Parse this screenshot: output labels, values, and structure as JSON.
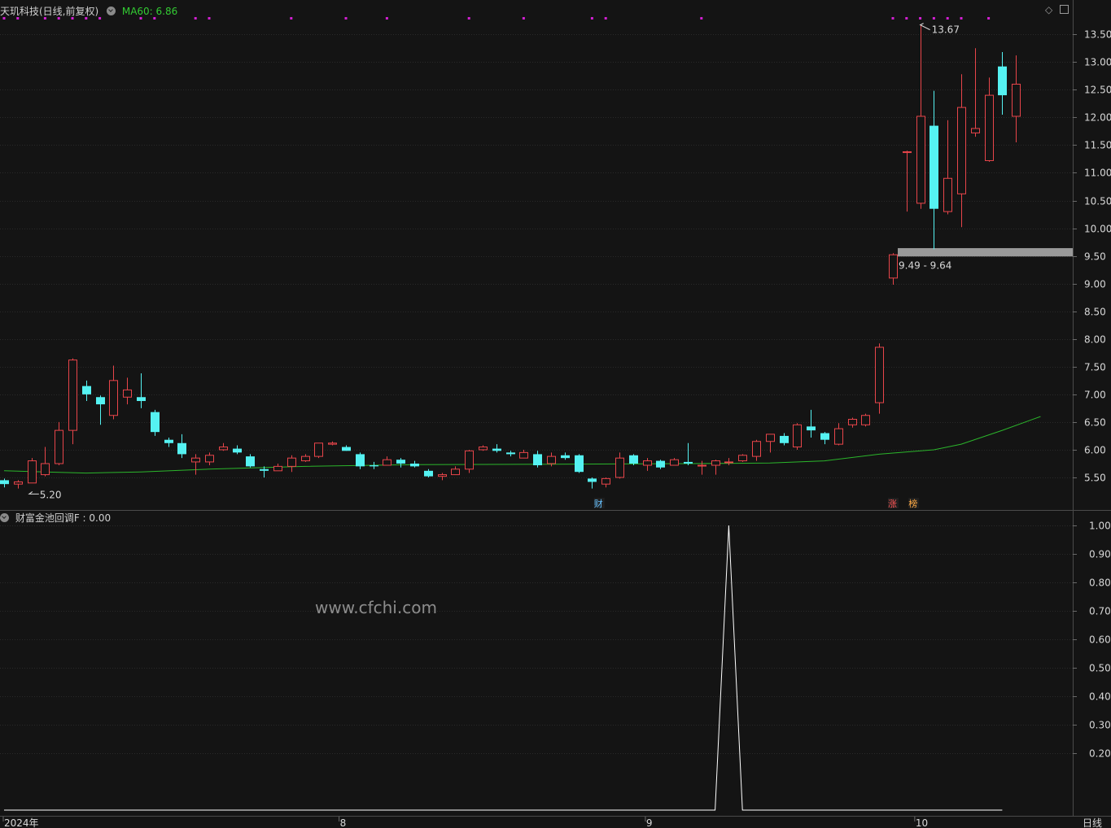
{
  "main_header": {
    "stock_name": "天玑科技(日线,前复权)",
    "ma_label": "MA60: 6.86"
  },
  "sub_header": {
    "indicator_label": "财富金池回调F : 0.00"
  },
  "watermark": "www.cfchi.com",
  "annotations": {
    "high_label": "13.67",
    "low_label": "5.20",
    "band_label": "9.49 - 9.64",
    "marker_cai": "财",
    "marker_zhang": "涨",
    "marker_bang": "榜"
  },
  "x_labels": [
    "2024年",
    "8",
    "9",
    "10"
  ],
  "period_label": "日线",
  "colors": {
    "background": "#141414",
    "up": "#e8454a",
    "down": "#55f2f2",
    "ma": "#2bb52b",
    "signal_dots": "#d21fd2",
    "indicator_line": "#ffffff",
    "band": "#9a9a9a",
    "ma_label": "#33cc33"
  },
  "chart_data": [
    {
      "type": "candlestick",
      "name": "天玑科技",
      "y_ticks": [
        "5.50",
        "6.00",
        "6.50",
        "7.00",
        "7.50",
        "8.00",
        "8.50",
        "9.00",
        "9.50",
        "10.00",
        "10.50",
        "11.00",
        "11.50",
        "12.00",
        "12.50",
        "13.00",
        "13.50"
      ],
      "ylim": [
        5.0,
        13.8
      ],
      "x_tick_labels": [
        "2024年",
        "8",
        "9",
        "10"
      ],
      "ohlc": [
        [
          5.45,
          5.48,
          5.32,
          5.38
        ],
        [
          5.38,
          5.45,
          5.3,
          5.42
        ],
        [
          5.4,
          5.85,
          5.4,
          5.8
        ],
        [
          5.55,
          6.05,
          5.52,
          5.75
        ],
        [
          5.75,
          6.5,
          5.72,
          6.35
        ],
        [
          6.35,
          7.65,
          6.1,
          7.62
        ],
        [
          7.15,
          7.25,
          6.88,
          7.0
        ],
        [
          6.95,
          6.98,
          6.45,
          6.82
        ],
        [
          6.62,
          7.52,
          6.55,
          7.25
        ],
        [
          6.95,
          7.3,
          6.82,
          7.08
        ],
        [
          6.95,
          7.38,
          6.75,
          6.88
        ],
        [
          6.68,
          6.72,
          6.25,
          6.32
        ],
        [
          6.18,
          6.22,
          6.05,
          6.12
        ],
        [
          6.12,
          6.28,
          5.85,
          5.92
        ],
        [
          5.78,
          5.92,
          5.55,
          5.85
        ],
        [
          5.78,
          5.95,
          5.72,
          5.9
        ],
        [
          6.0,
          6.12,
          5.98,
          6.05
        ],
        [
          6.02,
          6.08,
          5.92,
          5.95
        ],
        [
          5.88,
          5.92,
          5.68,
          5.7
        ],
        [
          5.65,
          5.7,
          5.5,
          5.62
        ],
        [
          5.62,
          5.75,
          5.62,
          5.7
        ],
        [
          5.7,
          5.9,
          5.6,
          5.85
        ],
        [
          5.8,
          5.92,
          5.78,
          5.88
        ],
        [
          5.88,
          6.12,
          5.85,
          6.12
        ],
        [
          6.1,
          6.15,
          6.08,
          6.12
        ],
        [
          6.05,
          6.08,
          5.98,
          5.98
        ],
        [
          5.92,
          5.95,
          5.65,
          5.7
        ],
        [
          5.72,
          5.78,
          5.65,
          5.7
        ],
        [
          5.72,
          5.88,
          5.72,
          5.82
        ],
        [
          5.82,
          5.85,
          5.68,
          5.75
        ],
        [
          5.75,
          5.8,
          5.68,
          5.7
        ],
        [
          5.62,
          5.65,
          5.5,
          5.52
        ],
        [
          5.52,
          5.58,
          5.45,
          5.55
        ],
        [
          5.55,
          5.7,
          5.55,
          5.65
        ],
        [
          5.65,
          6.0,
          5.58,
          5.98
        ],
        [
          6.0,
          6.08,
          5.98,
          6.05
        ],
        [
          6.02,
          6.1,
          5.95,
          5.98
        ],
        [
          5.95,
          5.98,
          5.88,
          5.92
        ],
        [
          5.85,
          6.0,
          5.85,
          5.95
        ],
        [
          5.92,
          5.98,
          5.68,
          5.72
        ],
        [
          5.75,
          5.95,
          5.7,
          5.88
        ],
        [
          5.9,
          5.95,
          5.82,
          5.85
        ],
        [
          5.9,
          5.92,
          5.58,
          5.6
        ],
        [
          5.48,
          5.5,
          5.3,
          5.42
        ],
        [
          5.38,
          5.5,
          5.32,
          5.48
        ],
        [
          5.5,
          5.95,
          5.48,
          5.85
        ],
        [
          5.9,
          5.92,
          5.72,
          5.75
        ],
        [
          5.72,
          5.85,
          5.62,
          5.8
        ],
        [
          5.8,
          5.82,
          5.65,
          5.68
        ],
        [
          5.72,
          5.85,
          5.72,
          5.82
        ],
        [
          5.78,
          6.12,
          5.72,
          5.75
        ],
        [
          5.72,
          5.8,
          5.55,
          5.72
        ],
        [
          5.72,
          5.82,
          5.55,
          5.8
        ],
        [
          5.78,
          5.85,
          5.72,
          5.78
        ],
        [
          5.8,
          5.92,
          5.78,
          5.9
        ],
        [
          5.88,
          6.18,
          5.8,
          6.15
        ],
        [
          6.15,
          6.28,
          5.95,
          6.28
        ],
        [
          6.25,
          6.3,
          6.08,
          6.12
        ],
        [
          6.05,
          6.48,
          6.0,
          6.45
        ],
        [
          6.42,
          6.72,
          6.22,
          6.35
        ],
        [
          6.3,
          6.32,
          6.1,
          6.18
        ],
        [
          6.1,
          6.48,
          6.08,
          6.38
        ],
        [
          6.45,
          6.58,
          6.4,
          6.55
        ],
        [
          6.45,
          6.65,
          6.42,
          6.62
        ],
        [
          6.85,
          7.92,
          6.65,
          7.85
        ],
        [
          9.1,
          9.55,
          8.98,
          9.52
        ],
        [
          11.38,
          11.4,
          10.3,
          11.38
        ],
        [
          10.45,
          13.67,
          10.35,
          12.02
        ],
        [
          11.85,
          12.48,
          9.62,
          10.35
        ],
        [
          10.3,
          11.95,
          10.25,
          10.9
        ],
        [
          10.62,
          12.78,
          10.02,
          12.18
        ],
        [
          11.72,
          13.25,
          11.65,
          11.8
        ],
        [
          11.22,
          12.72,
          11.2,
          12.4
        ],
        [
          12.92,
          13.18,
          12.05,
          12.4
        ],
        [
          12.02,
          13.12,
          11.55,
          12.6
        ]
      ],
      "ma60": [
        [
          5.62,
          0
        ],
        [
          5.6,
          3
        ],
        [
          5.58,
          6
        ],
        [
          5.6,
          10
        ],
        [
          5.65,
          15
        ],
        [
          5.7,
          22
        ],
        [
          5.73,
          30
        ],
        [
          5.74,
          40
        ],
        [
          5.75,
          50
        ],
        [
          5.76,
          56
        ],
        [
          5.8,
          60
        ],
        [
          5.92,
          64
        ],
        [
          6.0,
          68
        ],
        [
          6.1,
          70
        ],
        [
          6.35,
          73
        ],
        [
          6.6,
          75.8
        ]
      ],
      "support_band": [
        9.49,
        9.64
      ],
      "highest": 13.67,
      "lowest": 5.2
    },
    {
      "type": "line",
      "name": "财富金池回调F",
      "y_ticks": [
        "0.20",
        "0.30",
        "0.40",
        "0.50",
        "0.60",
        "0.70",
        "0.80",
        "0.90",
        "1.00"
      ],
      "ylim": [
        -0.062,
        1.04
      ],
      "values_note_free": true,
      "points": [
        [
          0,
          0
        ],
        [
          52,
          0
        ],
        [
          53,
          1
        ],
        [
          54,
          0
        ],
        [
          73,
          0
        ]
      ]
    }
  ]
}
